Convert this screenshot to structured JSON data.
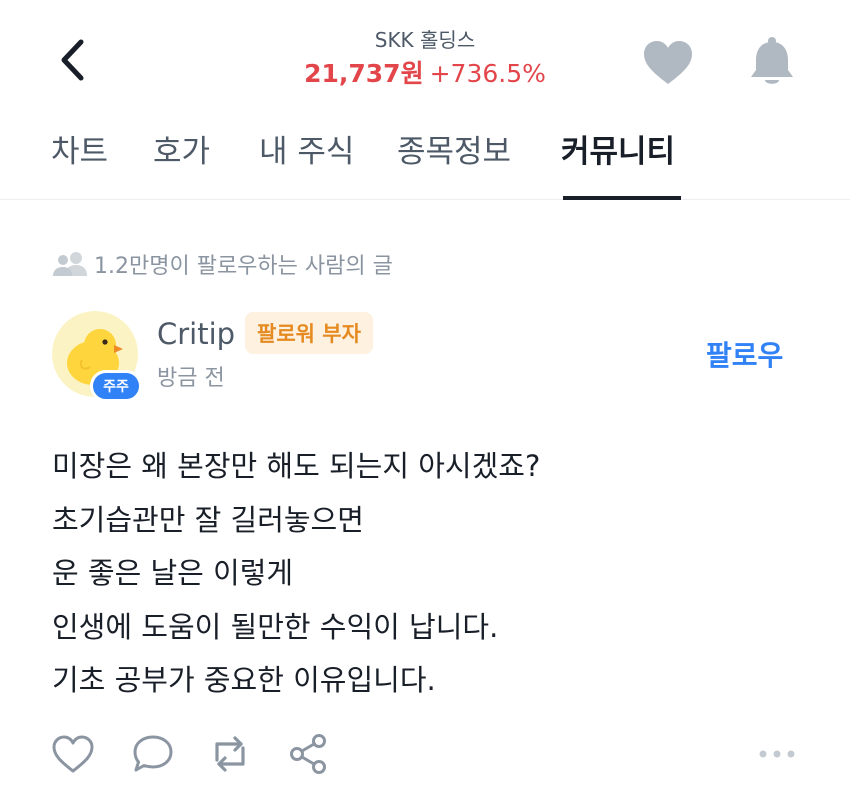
{
  "header": {
    "stock_name": "SKK 홀딩스",
    "price": "21,737원",
    "change": "+736.5%",
    "colors": {
      "price_up": "#e2464b",
      "icon_gray": "#adb5bd"
    },
    "icons": {
      "back": "chevron-left-icon",
      "favorite": "heart-icon",
      "alert": "bell-icon"
    }
  },
  "tabs": [
    {
      "label": "차트",
      "active": false
    },
    {
      "label": "호가",
      "active": false
    },
    {
      "label": "내 주식",
      "active": false
    },
    {
      "label": "종목정보",
      "active": false
    },
    {
      "label": "커뮤니티",
      "active": true
    }
  ],
  "community": {
    "follow_note": "1.2만명이 팔로우하는 사람의 글"
  },
  "post": {
    "author": "Critip",
    "author_badge": "팔로워 부자",
    "avatar_badge": "주주",
    "time": "방금 전",
    "follow_label": "팔로우",
    "lines": [
      "미장은 왜 본장만 해도 되는지 아시겠죠?",
      "초기습관만 잘 길러놓으면",
      "운 좋은 날은 이렇게",
      "인생에 도움이 될만한 수익이 납니다.",
      "기초 공부가 중요한 이유입니다."
    ],
    "actions": [
      "heart-outline-icon",
      "comment-icon",
      "repost-icon",
      "share-icon",
      "more-icon"
    ],
    "colors": {
      "accent": "#3182f6",
      "badge_bg": "#fff1e0",
      "badge_text": "#e58a21"
    }
  }
}
